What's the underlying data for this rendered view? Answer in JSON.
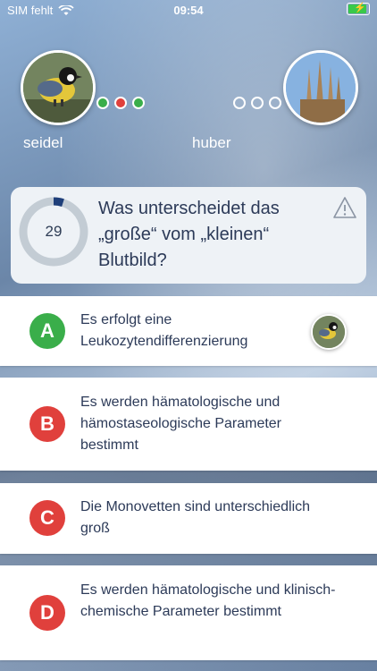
{
  "status": {
    "carrier": "SIM fehlt",
    "time": "09:54"
  },
  "players": {
    "left": {
      "name": "seidel",
      "avatar": "bird-avatar",
      "dots": [
        "green",
        "red",
        "green"
      ]
    },
    "right": {
      "name": "huber",
      "avatar": "church-avatar",
      "dots": [
        "empty",
        "empty",
        "empty"
      ]
    }
  },
  "question": {
    "timer": "29",
    "timer_fraction": 0.05,
    "text": "Was unterscheidet das „große“ vom „kleinen“ Blutbild?"
  },
  "answers": [
    {
      "letter": "A",
      "text": "Es erfolgt eine Leukozytendifferenzierung",
      "color": "green",
      "picked_by": "seidel"
    },
    {
      "letter": "B",
      "text": "Es werden hämatologische und hämostaseologische Parameter bestimmt",
      "color": "red"
    },
    {
      "letter": "C",
      "text": "Die Monovetten sind unterschiedlich groß",
      "color": "red"
    },
    {
      "letter": "D",
      "text": "Es werden hämatologische und klinisch-chemische Parameter bestimmt",
      "color": "red"
    }
  ],
  "colors": {
    "green": "#3aae4a",
    "red": "#e0403c",
    "text": "#2c3a58"
  }
}
